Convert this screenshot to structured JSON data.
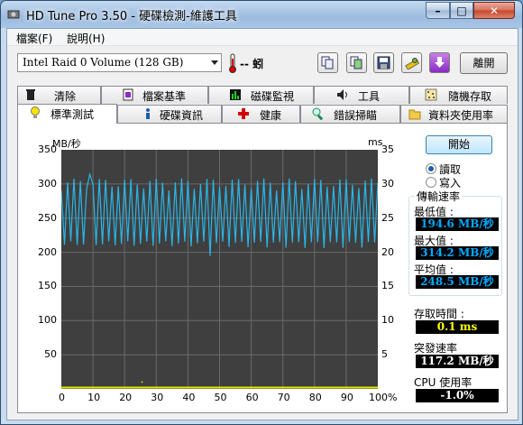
{
  "window": {
    "title": "HD Tune Pro 3.50 - 硬碟檢測-維護工具",
    "min_glyph": "–",
    "max_glyph": "□",
    "close_glyph": "✕"
  },
  "menu": [
    "檔案(F)",
    "說明(H)"
  ],
  "toolbar": {
    "drive": "Intel   Raid 0 Volume (128 GB)",
    "temperature": "-- 蚓",
    "buttons": [
      "copy-info-icon",
      "copy-screenshot-icon",
      "save-icon",
      "options-icon",
      "download-icon"
    ],
    "exit_label": "離開"
  },
  "tabs_top": [
    "清除",
    "檔案基準",
    "磁碟監視",
    "工具",
    "隨機存取"
  ],
  "tabs_bottom": [
    "標準測試",
    "硬碟資訊",
    "健康",
    "錯誤掃瞄",
    "資料夾使用率"
  ],
  "active_tab": "標準測試",
  "controls": {
    "start_label": "開始",
    "mode_options": [
      "讀取",
      "寫入"
    ],
    "selected_mode": "讀取"
  },
  "stats": {
    "transfer_rate_label": "傳輸速率",
    "min_label": "最低值 :",
    "min_value": "194.6 MB/秒",
    "max_label": "最大值 :",
    "max_value": "314.2 MB/秒",
    "avg_label": "平均值 :",
    "avg_value": "248.5 MB/秒",
    "access_time_label": "存取時間 :",
    "access_time_value": "0.1 ms",
    "burst_label": "突發速率",
    "burst_value": "117.2 MB/秒",
    "cpu_label": "CPU 使用率",
    "cpu_value": "-1.0%"
  },
  "chart_data": {
    "type": "line",
    "ylabel_left": "MB/秒",
    "ylabel_right": "ms",
    "y_ticks_left": [
      "350",
      "300",
      "250",
      "200",
      "150",
      "100",
      "50"
    ],
    "y_ticks_right": [
      "35",
      "30",
      "25",
      "20",
      "15",
      "10",
      "5"
    ],
    "x_ticks": [
      "0",
      "10",
      "20",
      "30",
      "40",
      "50",
      "60",
      "70",
      "80",
      "90",
      "100%"
    ],
    "ylim": [
      0,
      350
    ],
    "xlim": [
      0,
      100
    ],
    "grid": true,
    "series": [
      {
        "color": "#29b6e8",
        "y_max": 314.2,
        "y_min": 194.6,
        "y_mean": 248.5,
        "oscillations": 50
      },
      {
        "color": "#e8e800",
        "level_ms": 0.1
      }
    ]
  }
}
